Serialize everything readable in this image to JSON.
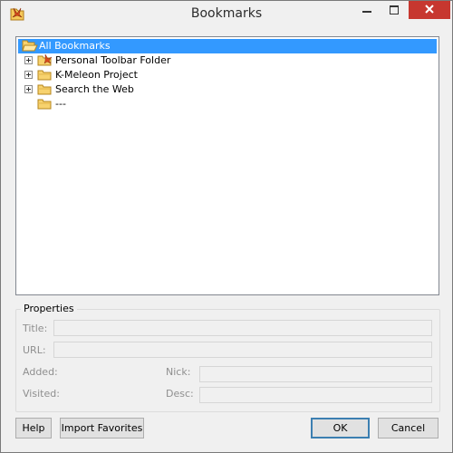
{
  "window": {
    "title": "Bookmarks",
    "accent_color": "#3399ff",
    "close_color": "#c7372f",
    "icons": [
      "app-icon",
      "minimize-icon",
      "maximize-icon",
      "close-icon"
    ]
  },
  "tree": {
    "items": [
      {
        "label": "All Bookmarks",
        "selected": true,
        "icon": "open-folder-icon"
      },
      {
        "label": "Personal Toolbar Folder",
        "expandable": true,
        "icon": "toolbar-folder-icon"
      },
      {
        "label": "K-Meleon Project",
        "expandable": true,
        "icon": "folder-icon"
      },
      {
        "label": "Search the Web",
        "expandable": true,
        "icon": "folder-icon"
      },
      {
        "label": "---",
        "expandable": false,
        "icon": "folder-icon"
      }
    ]
  },
  "properties": {
    "title": "Properties",
    "title_label": "Title:",
    "url_label": "URL:",
    "added_label": "Added:",
    "visited_label": "Visited:",
    "nick_label": "Nick:",
    "desc_label": "Desc:"
  },
  "buttons": {
    "help": "Help",
    "import_favorites": "Import Favorites",
    "ok": "OK",
    "cancel": "Cancel"
  }
}
